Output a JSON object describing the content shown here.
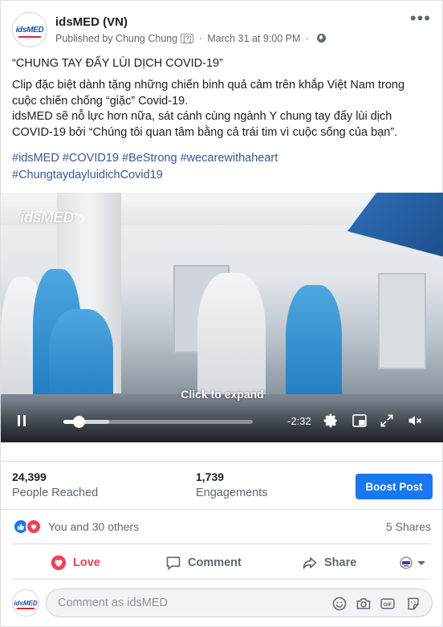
{
  "post": {
    "page_name": "idsMED (VN)",
    "published_by": "Published by Chung Chung",
    "help_marker": "[?]",
    "separator": "·",
    "date": "March 31 at 9:00 PM",
    "logo_text": "idsMED"
  },
  "body": {
    "line1": "“CHUNG TAY ĐẨY LÙI DỊCH COVID-19”",
    "paragraph": "Clip đặc biệt dành tặng những chiến binh quả cảm trên khắp Việt Nam trong cuộc chiến chống “giặc” Covid-19.",
    "paragraph2": "idsMED sẽ nỗ lực hơn nữa, sát cánh cùng ngành Y chung tay đẩy lùi dịch COVID-19 bởi “Chúng tôi quan tâm bằng cả trái tim vì cuộc sống của bạn”.",
    "hashtags": [
      "#idsMED",
      "#COVID19",
      "#BeStrong",
      "#wecarewithaheart",
      "#ChungtaydayluidichCovid19"
    ]
  },
  "video": {
    "watermark": "idsMED",
    "expand_text": "Click to expand",
    "time_remaining": "-2:32",
    "progress_fraction": 0.08,
    "buffered_fraction": 0.24
  },
  "stats": {
    "reached_value": "24,399",
    "reached_label": "People Reached",
    "engagements_value": "1,739",
    "engagements_label": "Engagements",
    "boost_label": "Boost Post"
  },
  "reactions": {
    "summary": "You and 30 others",
    "shares": "5 Shares"
  },
  "actions": {
    "love": "Love",
    "comment": "Comment",
    "share": "Share"
  },
  "composer": {
    "placeholder": "Comment as idsMED"
  },
  "colors": {
    "accent": "#1877f2",
    "love": "#f33e58",
    "link": "#385898"
  }
}
